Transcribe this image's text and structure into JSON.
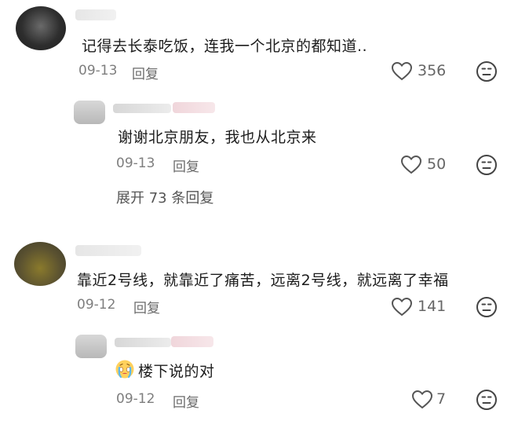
{
  "comments": [
    {
      "text": "记得去长泰吃饭，连我一个北京的都知道..",
      "date": "09-13",
      "reply_label": "回复",
      "likes": "356"
    },
    {
      "text": "谢谢北京朋友，我也从北京来",
      "date": "09-13",
      "reply_label": "回复",
      "likes": "50"
    },
    {
      "text": "靠近2号线，就靠近了痛苦，远离2号线，就远离了幸福",
      "date": "09-12",
      "reply_label": "回复",
      "likes": "141"
    },
    {
      "text": "楼下说的对",
      "date": "09-12",
      "reply_label": "回复",
      "likes": "7"
    }
  ],
  "expand_replies_label": "展开 73 条回复",
  "icons": {
    "like": "heart-outline-icon",
    "dislike": "frown-face-icon",
    "emoji": "crying-face-emoji"
  }
}
